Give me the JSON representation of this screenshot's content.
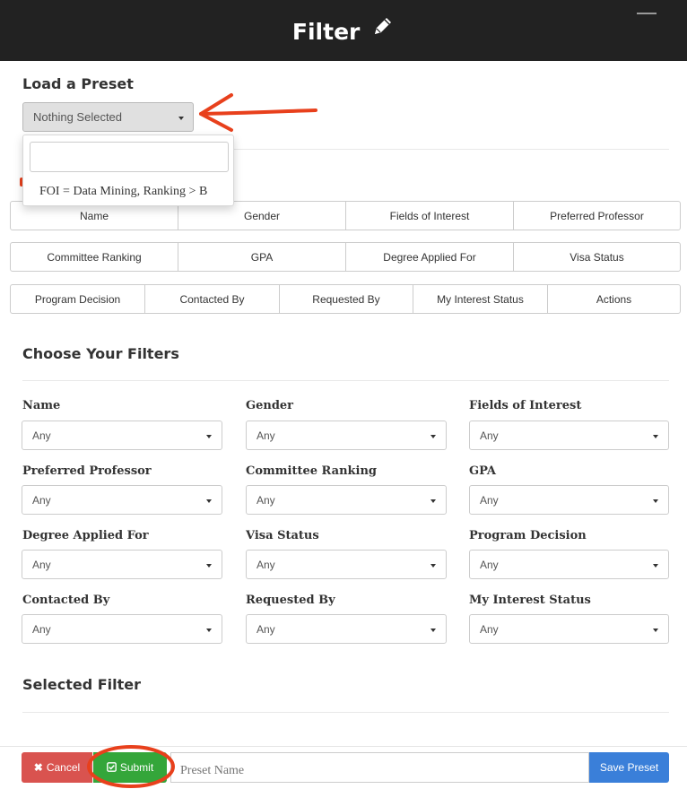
{
  "header": {
    "title": "Filter",
    "title_icon": "pencil-icon"
  },
  "preset": {
    "heading": "Load a Preset",
    "selected": "Nothing Selected",
    "search_value": "",
    "options": [
      "FOI = Data Mining, Ranking > B"
    ]
  },
  "columns": {
    "row1": [
      "Name",
      "Gender",
      "Fields of Interest",
      "Preferred Professor"
    ],
    "row2": [
      "Committee Ranking",
      "GPA",
      "Degree Applied For",
      "Visa Status"
    ],
    "row3": [
      "Program Decision",
      "Contacted By",
      "Requested By",
      "My Interest Status",
      "Actions"
    ]
  },
  "filters": {
    "heading": "Choose Your Filters",
    "items": [
      {
        "label": "Name",
        "value": "Any"
      },
      {
        "label": "Gender",
        "value": "Any"
      },
      {
        "label": "Fields of Interest",
        "value": "Any"
      },
      {
        "label": "Preferred Professor",
        "value": "Any"
      },
      {
        "label": "Committee Ranking",
        "value": "Any"
      },
      {
        "label": "GPA",
        "value": "Any"
      },
      {
        "label": "Degree Applied For",
        "value": "Any"
      },
      {
        "label": "Visa Status",
        "value": "Any"
      },
      {
        "label": "Program Decision",
        "value": "Any"
      },
      {
        "label": "Contacted By",
        "value": "Any"
      },
      {
        "label": "Requested By",
        "value": "Any"
      },
      {
        "label": "My Interest Status",
        "value": "Any"
      }
    ]
  },
  "selected_filter": {
    "heading": "Selected Filter"
  },
  "footer": {
    "cancel_label": "Cancel",
    "submit_label": "Submit",
    "preset_name_placeholder": "Preset Name",
    "save_label": "Save Preset"
  },
  "colors": {
    "header_bg": "#222222",
    "cancel": "#d9534f",
    "submit": "#34a63a",
    "save": "#3a7fd9",
    "annotation": "#e8401c"
  }
}
